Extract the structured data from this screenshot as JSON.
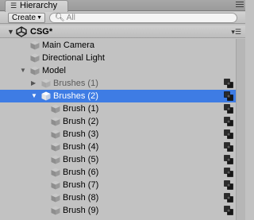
{
  "window": {
    "tab_label": "Hierarchy",
    "tab_icon": "hierarchy-list-icon"
  },
  "toolbar": {
    "create_label": "Create",
    "search_placeholder": "All"
  },
  "scene": {
    "name": "CSG*",
    "icon": "unity-logo-icon"
  },
  "tree": [
    {
      "name": "main-camera",
      "label": "Main Camera",
      "depth": 1,
      "expander": "",
      "selected": false,
      "dim": false,
      "csg": false
    },
    {
      "name": "directional-light",
      "label": "Directional Light",
      "depth": 1,
      "expander": "",
      "selected": false,
      "dim": false,
      "csg": false
    },
    {
      "name": "model",
      "label": "Model",
      "depth": 1,
      "expander": "▼",
      "selected": false,
      "dim": false,
      "csg": false
    },
    {
      "name": "brushes-1",
      "label": "Brushes (1)",
      "depth": 2,
      "expander": "▶",
      "selected": false,
      "dim": true,
      "csg": true
    },
    {
      "name": "brushes-2",
      "label": "Brushes (2)",
      "depth": 2,
      "expander": "▼",
      "selected": true,
      "dim": false,
      "csg": true
    },
    {
      "name": "brush-1",
      "label": "Brush (1)",
      "depth": 3,
      "expander": "",
      "selected": false,
      "dim": false,
      "csg": true
    },
    {
      "name": "brush-2",
      "label": "Brush (2)",
      "depth": 3,
      "expander": "",
      "selected": false,
      "dim": false,
      "csg": true
    },
    {
      "name": "brush-3",
      "label": "Brush (3)",
      "depth": 3,
      "expander": "",
      "selected": false,
      "dim": false,
      "csg": true
    },
    {
      "name": "brush-4",
      "label": "Brush (4)",
      "depth": 3,
      "expander": "",
      "selected": false,
      "dim": false,
      "csg": true
    },
    {
      "name": "brush-5",
      "label": "Brush (5)",
      "depth": 3,
      "expander": "",
      "selected": false,
      "dim": false,
      "csg": true
    },
    {
      "name": "brush-6",
      "label": "Brush (6)",
      "depth": 3,
      "expander": "",
      "selected": false,
      "dim": false,
      "csg": true
    },
    {
      "name": "brush-7",
      "label": "Brush (7)",
      "depth": 3,
      "expander": "",
      "selected": false,
      "dim": false,
      "csg": true
    },
    {
      "name": "brush-8",
      "label": "Brush (8)",
      "depth": 3,
      "expander": "",
      "selected": false,
      "dim": false,
      "csg": true
    },
    {
      "name": "brush-9",
      "label": "Brush (9)",
      "depth": 3,
      "expander": "",
      "selected": false,
      "dim": false,
      "csg": true
    }
  ],
  "colors": {
    "selection": "#3e7ce4",
    "panel_bg": "#c2c2c2"
  }
}
